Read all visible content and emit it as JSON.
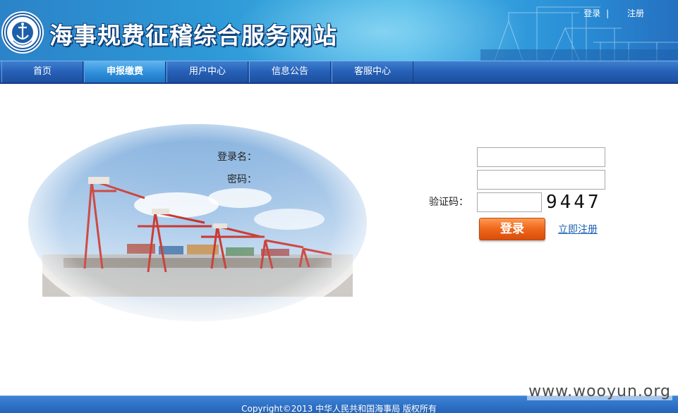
{
  "header": {
    "site_title": "海事规费征稽综合服务网站",
    "logo_text": "CHINA MSA",
    "top_links": {
      "login": "登录",
      "separator": "|",
      "register": "注册"
    }
  },
  "nav": {
    "items": [
      {
        "label": "首页",
        "active": false
      },
      {
        "label": "申报缴费",
        "active": true
      },
      {
        "label": "用户中心",
        "active": false
      },
      {
        "label": "信息公告",
        "active": false
      },
      {
        "label": "客服中心",
        "active": false
      }
    ]
  },
  "login_form": {
    "username_label": "登录名：",
    "username_value": "",
    "password_label": "密码：",
    "password_value": "",
    "captcha_label": "验证码：",
    "captcha_value": "",
    "captcha_code": "9447",
    "login_button": "登录",
    "register_link": "立即注册"
  },
  "footer": {
    "copyright": "Copyright©2013 中华人民共和国海事局  版权所有"
  },
  "watermark": "www.wooyun.org",
  "colors": {
    "banner_blue": "#2d98d6",
    "nav_blue": "#2660b6",
    "nav_active": "#2f8fd9",
    "login_orange": "#f06a1f",
    "link_blue": "#1a5fb4"
  }
}
